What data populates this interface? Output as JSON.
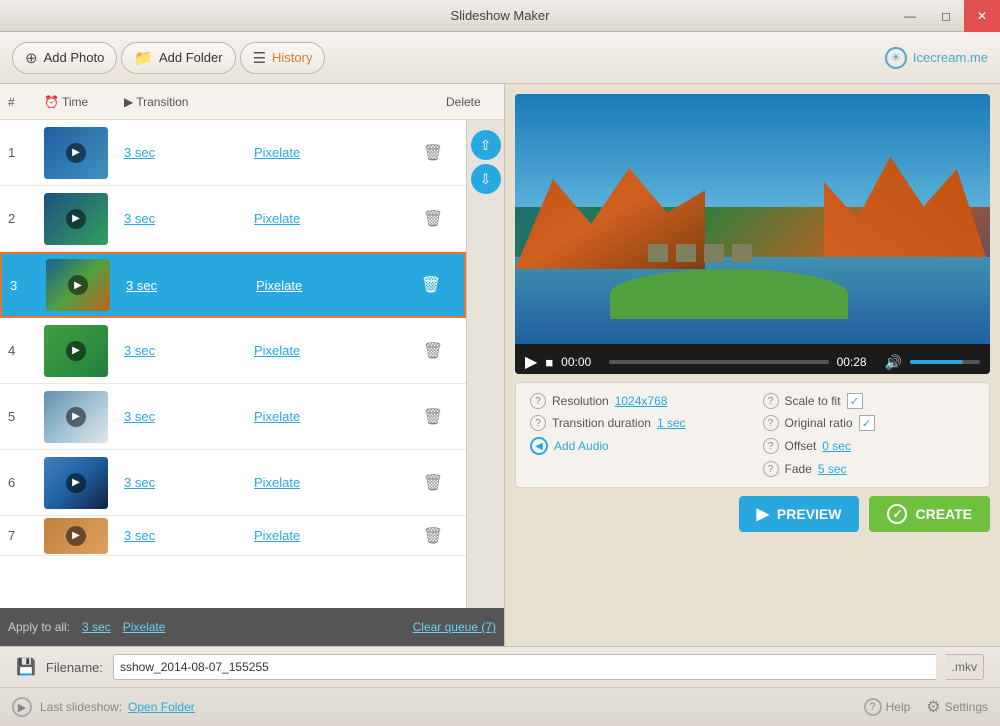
{
  "window": {
    "title": "Slideshow Maker"
  },
  "toolbar": {
    "add_photo": "Add Photo",
    "add_folder": "Add Folder",
    "history": "History",
    "icecream": "Icecream.me"
  },
  "table": {
    "col_num": "#",
    "col_time": "Time",
    "col_transition": "Transition",
    "col_delete": "Delete"
  },
  "slides": [
    {
      "num": "1",
      "time": "3 sec",
      "transition": "Pixelate",
      "thumb_class": "thumb-1"
    },
    {
      "num": "2",
      "time": "3 sec",
      "transition": "Pixelate",
      "thumb_class": "thumb-2"
    },
    {
      "num": "3",
      "time": "3 sec",
      "transition": "Pixelate",
      "thumb_class": "thumb-3",
      "selected": true
    },
    {
      "num": "4",
      "time": "3 sec",
      "transition": "Pixelate",
      "thumb_class": "thumb-4"
    },
    {
      "num": "5",
      "time": "3 sec",
      "transition": "Pixelate",
      "thumb_class": "thumb-5"
    },
    {
      "num": "6",
      "time": "3 sec",
      "transition": "Pixelate",
      "thumb_class": "thumb-6"
    },
    {
      "num": "7",
      "time": "3 sec",
      "transition": "Pixelate",
      "thumb_class": "thumb-7"
    }
  ],
  "apply_bar": {
    "label": "Apply to all:",
    "time": "3 sec",
    "transition": "Pixelate",
    "clear": "Clear queue (7)"
  },
  "video": {
    "time_current": "00:00",
    "time_total": "00:28"
  },
  "settings": {
    "resolution_label": "Resolution",
    "resolution_value": "1024x768",
    "transition_duration_label": "Transition duration",
    "transition_duration_value": "1 sec",
    "scale_to_fit_label": "Scale to fit",
    "original_ratio_label": "Original ratio",
    "offset_label": "Offset",
    "offset_value": "0 sec",
    "fade_label": "Fade",
    "fade_value": "5 sec",
    "add_audio_label": "Add Audio"
  },
  "filename": {
    "label": "Filename:",
    "value": "sshow_2014-08-07_155255",
    "ext": ".mkv",
    "placeholder": "sshow_2014-08-07_155255"
  },
  "footer": {
    "last_slideshow": "Last slideshow:",
    "open_folder": "Open Folder",
    "help": "Help",
    "settings": "Settings"
  },
  "buttons": {
    "preview": "PREVIEW",
    "create": "CREATE"
  }
}
